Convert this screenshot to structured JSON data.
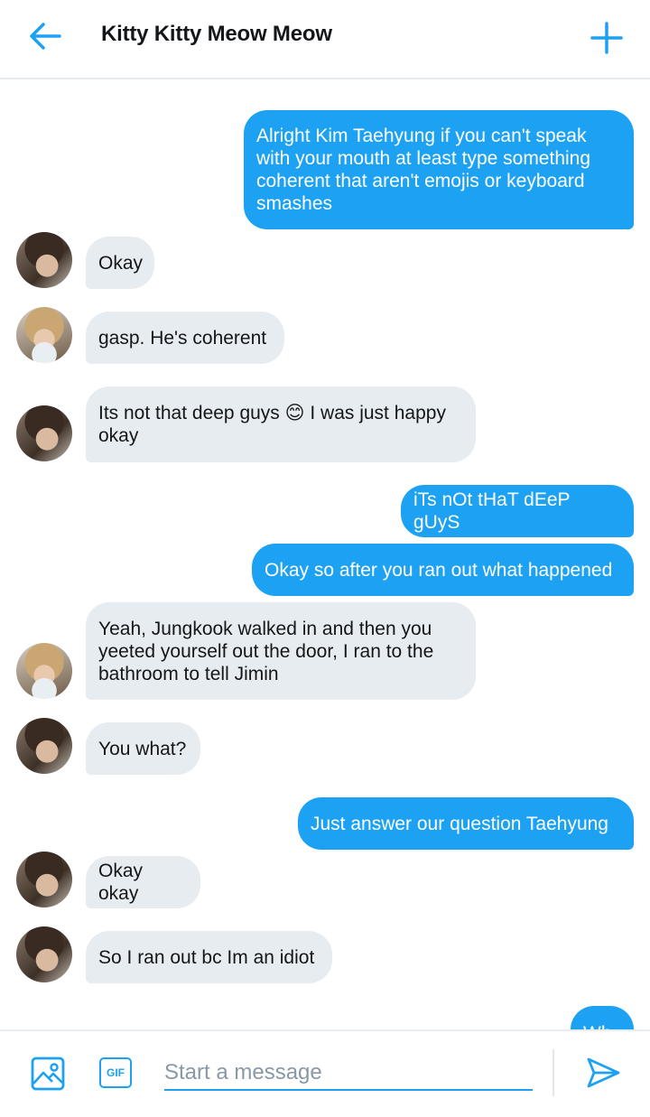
{
  "header": {
    "title": "Kitty Kitty Meow Meow",
    "back_icon": "arrow-left-icon",
    "add_icon": "plus-icon"
  },
  "colors": {
    "accent": "#1da1f2",
    "incoming_bubble": "#e6ecf0",
    "text": "#14171a",
    "placeholder": "#8899a6"
  },
  "messages": [
    {
      "direction": "outgoing",
      "text": "Alright Kim Taehyung if you can't speak\nwith your mouth at least type something\ncoherent that aren't emojis or keyboard\nsmashes"
    },
    {
      "direction": "incoming",
      "avatar": "avatar-1",
      "text": "Okay"
    },
    {
      "direction": "incoming",
      "avatar": "avatar-2",
      "text": "gasp. He's coherent"
    },
    {
      "direction": "incoming",
      "avatar": "avatar-1",
      "text": "Its not that deep guys 😊 I was just happy\nokay"
    },
    {
      "direction": "outgoing",
      "text": "iTs nOt tHaT dEeP gUyS"
    },
    {
      "direction": "outgoing",
      "text": "Okay so after you ran out what happened"
    },
    {
      "direction": "incoming",
      "avatar": "avatar-2",
      "text": "Yeah, Jungkook walked in and then you\nyeeted yourself out the door, I ran to the\nbathroom to tell Jimin"
    },
    {
      "direction": "incoming",
      "avatar": "avatar-1",
      "text": "You what?"
    },
    {
      "direction": "outgoing",
      "text": "Just answer our question Taehyung"
    },
    {
      "direction": "incoming",
      "avatar": "avatar-1",
      "text": "Okay okay"
    },
    {
      "direction": "incoming",
      "avatar": "avatar-1",
      "text": "So I ran out bc Im an idiot"
    },
    {
      "direction": "outgoing",
      "text": "Wh"
    }
  ],
  "composer": {
    "placeholder": "Start a message",
    "gif_label": "GIF",
    "image_icon": "image-icon",
    "send_icon": "send-icon"
  }
}
